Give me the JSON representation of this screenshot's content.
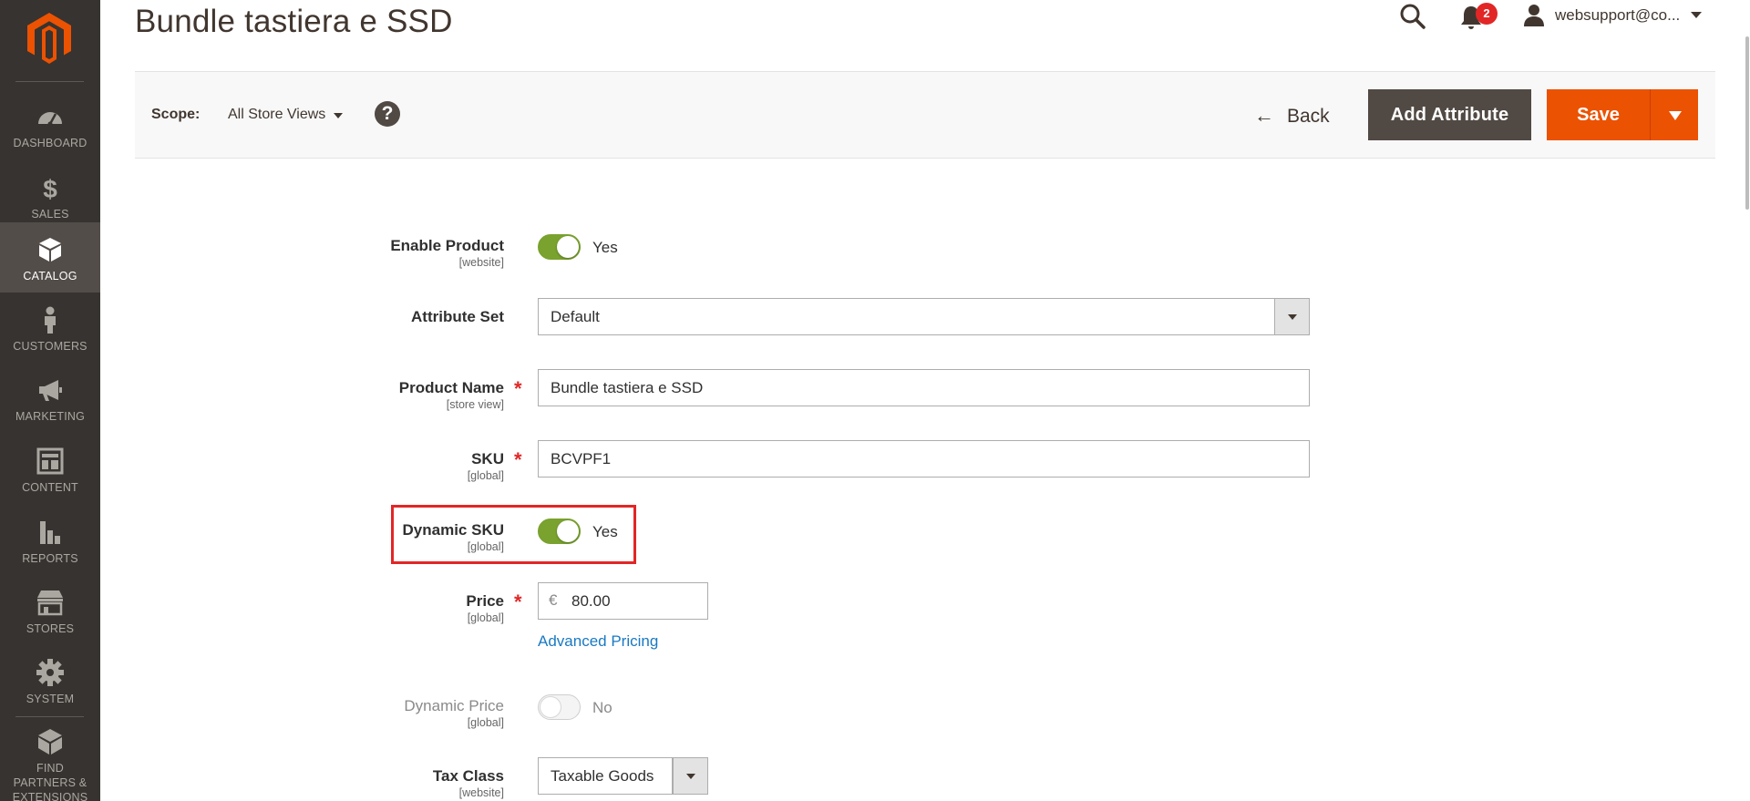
{
  "sidebar": {
    "items": [
      {
        "label": "DASHBOARD",
        "icon": "dashboard-icon"
      },
      {
        "label": "SALES",
        "icon": "dollar-icon"
      },
      {
        "label": "CATALOG",
        "icon": "box-icon"
      },
      {
        "label": "CUSTOMERS",
        "icon": "person-icon"
      },
      {
        "label": "MARKETING",
        "icon": "megaphone-icon"
      },
      {
        "label": "CONTENT",
        "icon": "layout-icon"
      },
      {
        "label": "REPORTS",
        "icon": "bar-chart-icon"
      },
      {
        "label": "STORES",
        "icon": "storefront-icon"
      },
      {
        "label": "SYSTEM",
        "icon": "gear-icon"
      },
      {
        "label": "FIND PARTNERS & EXTENSIONS",
        "icon": "blocks-icon"
      }
    ],
    "active": "CATALOG"
  },
  "header": {
    "title": "Bundle tastiera e SSD",
    "notification_count": "2",
    "user": "websupport@co..."
  },
  "actions": {
    "scope_label": "Scope:",
    "scope_value": "All Store Views",
    "help": "?",
    "back_label": "Back",
    "add_attribute_label": "Add Attribute",
    "save_label": "Save"
  },
  "form": {
    "enable_product": {
      "label": "Enable Product",
      "scope": "[website]",
      "value": "Yes"
    },
    "attribute_set": {
      "label": "Attribute Set",
      "value": "Default"
    },
    "product_name": {
      "label": "Product Name",
      "scope": "[store view]",
      "value": "Bundle tastiera e SSD"
    },
    "sku": {
      "label": "SKU",
      "scope": "[global]",
      "value": "BCVPF1"
    },
    "dynamic_sku": {
      "label": "Dynamic SKU",
      "scope": "[global]",
      "value": "Yes"
    },
    "price": {
      "label": "Price",
      "scope": "[global]",
      "currency": "€",
      "value": "80.00",
      "advanced_link": "Advanced Pricing"
    },
    "dynamic_price": {
      "label": "Dynamic Price",
      "scope": "[global]",
      "value": "No"
    },
    "tax_class": {
      "label": "Tax Class",
      "scope": "[website]",
      "value": "Taxable Goods"
    }
  },
  "colors": {
    "sidebar_bg": "#373330",
    "sidebar_active": "#524d49",
    "accent_orange": "#eb5202",
    "toggle_on": "#79a22e",
    "link_blue": "#1979c3",
    "required_red": "#e22626"
  }
}
